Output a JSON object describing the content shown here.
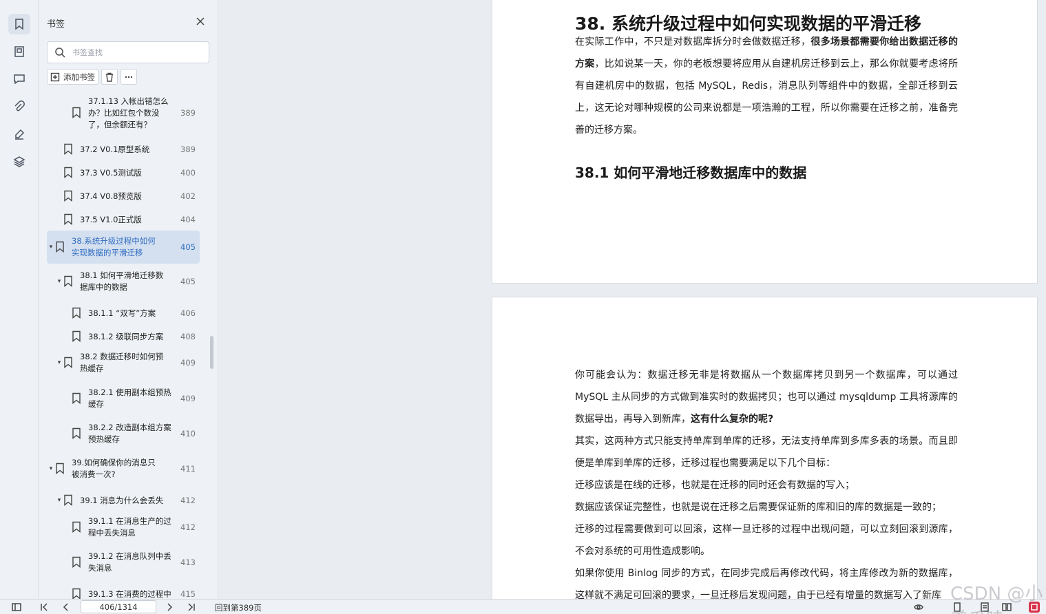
{
  "rail": {
    "items": [
      {
        "name": "bookmark-icon",
        "active": true
      },
      {
        "name": "thumbnail-icon",
        "active": false
      },
      {
        "name": "comment-icon",
        "active": false
      },
      {
        "name": "attachment-icon",
        "active": false
      },
      {
        "name": "signature-icon",
        "active": false
      },
      {
        "name": "layers-icon",
        "active": false
      }
    ]
  },
  "panel": {
    "title": "书签",
    "search_placeholder": "书签查找",
    "add_label": "添加书签"
  },
  "bookmarks": [
    {
      "text": "37.1.13 入帐出错怎么办？比如红包个数没了，但余额还有？",
      "page": "389",
      "level": 2,
      "expand": "",
      "active": false
    },
    {
      "text": "37.2 V0.1原型系统",
      "page": "389",
      "level": 1,
      "expand": "",
      "active": false
    },
    {
      "text": "37.3 V0.5测试版",
      "page": "400",
      "level": 1,
      "expand": "",
      "active": false
    },
    {
      "text": "37.4 V0.8预览版",
      "page": "402",
      "level": 1,
      "expand": "",
      "active": false
    },
    {
      "text": "37.5 V1.0正式版",
      "page": "404",
      "level": 1,
      "expand": "",
      "active": false
    },
    {
      "text": "38.系统升级过程中如何实现数据的平滑迁移",
      "page": "405",
      "level": 0,
      "expand": "▾",
      "active": true
    },
    {
      "text": "38.1 如何平滑地迁移数据库中的数据",
      "page": "405",
      "level": 1,
      "expand": "▾",
      "active": false
    },
    {
      "text": "38.1.1 “双写”方案",
      "page": "406",
      "level": 2,
      "expand": "",
      "active": false
    },
    {
      "text": "38.1.2 级联同步方案",
      "page": "408",
      "level": 2,
      "expand": "",
      "active": false
    },
    {
      "text": "38.2 数据迁移时如何预热缓存",
      "page": "409",
      "level": 1,
      "expand": "▾",
      "active": false
    },
    {
      "text": "38.2.1 使用副本组预热缓存",
      "page": "409",
      "level": 2,
      "expand": "",
      "active": false
    },
    {
      "text": "38.2.2 改造副本组方案预热缓存",
      "page": "410",
      "level": 2,
      "expand": "",
      "active": false
    },
    {
      "text": "39.如何确保你的消息只被消费一次?",
      "page": "411",
      "level": 0,
      "expand": "▾",
      "active": false
    },
    {
      "text": "39.1 消息为什么会丢失",
      "page": "412",
      "level": 1,
      "expand": "▾",
      "active": false
    },
    {
      "text": "39.1.1 在消息生产的过程中丢失消息",
      "page": "412",
      "level": 2,
      "expand": "",
      "active": false
    },
    {
      "text": "39.1.2 在消息队列中丢失消息",
      "page": "413",
      "level": 2,
      "expand": "",
      "active": false
    },
    {
      "text": "39.1.3 在消费的过程中",
      "page": "415",
      "level": 2,
      "expand": "",
      "active": false
    }
  ],
  "document": {
    "chapter_title": "38.  系统升级过程中如何实现数据的平滑迁移",
    "section_title": "38.1  如何平滑地迁移数据库中的数据",
    "intro": [
      {
        "t": "在实际工作中，不只是对数据库拆分时会做数据迁移，"
      },
      {
        "t": "很多场景都需要你给出数据迁移的方案",
        "b": true
      },
      {
        "t": "，比如说某一天，你的老板想要将应用从自建机房迁移到云上，那么你就要考虑将所有自建机房中的数据，包括 MySQL，Redis，消息队列等组件中的数据，全部迁移到云上，这无论对哪种规模的公司来说都是一项浩瀚的工程，所以你需要在迁移之前，准备完善的迁移方案。"
      }
    ],
    "body": [
      {
        "t": "你可能会认为：数据迁移无非是将数据从一个数据库拷贝到另一个数据库，可以通过 MySQL 主从同步的方式做到准实时的数据拷贝；也可以通过 mysqldump 工具将源库的数据导出，再导入到新库，"
      },
      {
        "t": "这有什么复杂的呢?",
        "b": true
      },
      {
        "t": "\n其实，这两种方式只能支持单库到单库的迁移，无法支持单库到多库多表的场景。而且即便是单库到单库的迁移，迁移过程也需要满足以下几个目标：\n迁移应该是在线的迁移，也就是在迁移的同时还会有数据的写入；\n数据应该保证完整性，也就是说在迁移之后需要保证新的库和旧的库的数据是一致的；\n迁移的过程需要做到可以回滚，这样一旦迁移的过程中出现问题，可以立刻回滚到源库，不会对系统的可用性造成影响。\n如果你使用 Binlog 同步的方式，在同步完成后再修改代码，将主库修改为新的数据库，这样就不满足可回滚的要求，一旦迁移后发现问题，由于已经有增量的数据写入了新库"
      }
    ]
  },
  "status": {
    "page_value": "406/1314",
    "back_label": "回到第389页",
    "watermark": "CSDN @小美爪哇"
  }
}
